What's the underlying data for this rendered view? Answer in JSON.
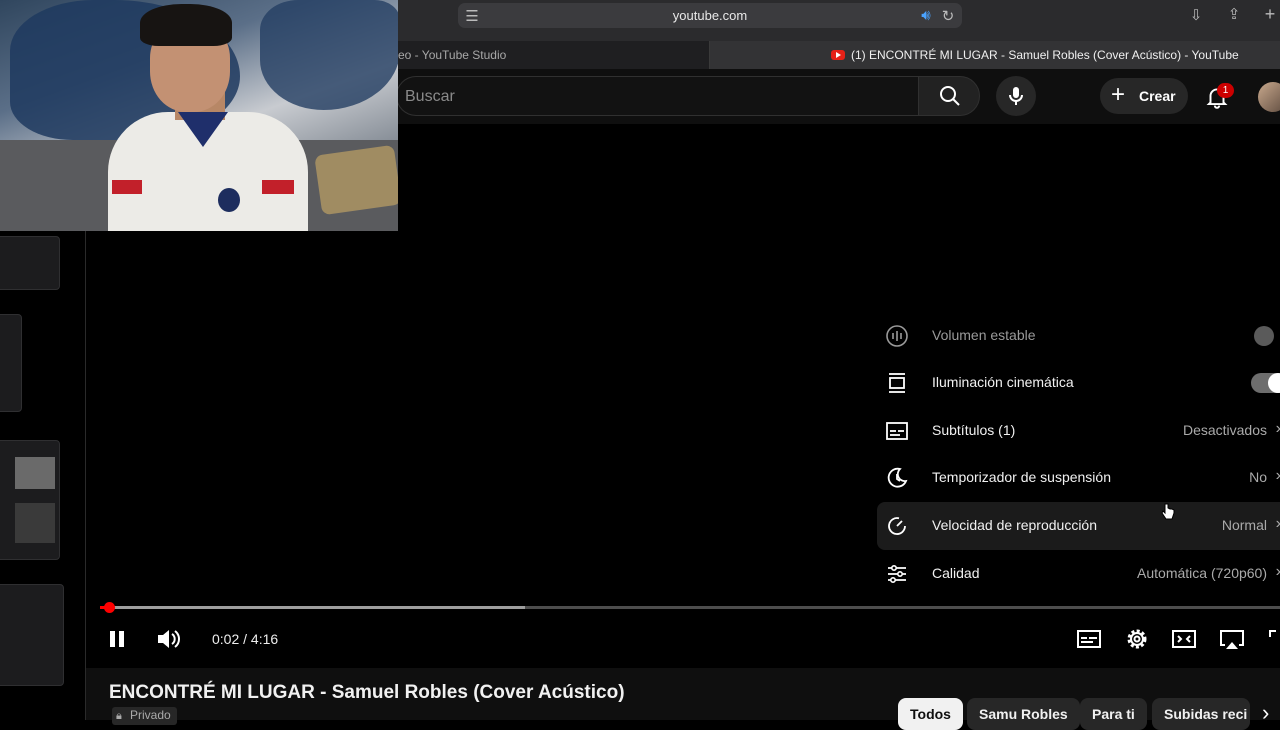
{
  "browser": {
    "url": "youtube.com",
    "tabs": [
      {
        "label": "eo - YouTube Studio"
      },
      {
        "label": "(1) ENCONTRÉ MI LUGAR - Samuel Robles (Cover Acústico) - YouTube"
      }
    ]
  },
  "header": {
    "search_placeholder": "Buscar",
    "create_label": "Crear",
    "notification_count": "1"
  },
  "player": {
    "time": "0:02 / 4:16",
    "progress_fraction": 0.008,
    "buffer_fraction": 0.36,
    "settings_menu": [
      {
        "label": "Volumen estable",
        "value": "",
        "icon": "stable-volume-icon",
        "control": "toggle-off",
        "dim": true
      },
      {
        "label": "Iluminación cinemática",
        "value": "",
        "icon": "ambient-mode-icon",
        "control": "toggle-on"
      },
      {
        "label": "Subtítulos (1)",
        "value": "Desactivados",
        "icon": "subtitles-icon"
      },
      {
        "label": "Temporizador de suspensión",
        "value": "No",
        "icon": "sleep-timer-icon"
      },
      {
        "label": "Velocidad de reproducción",
        "value": "Normal",
        "icon": "playback-speed-icon",
        "highlighted": true
      },
      {
        "label": "Calidad",
        "value": "Automática (720p60)",
        "icon": "quality-icon"
      }
    ]
  },
  "video": {
    "title": "ENCONTRÉ MI LUGAR - Samuel Robles (Cover Acústico)",
    "privacy": "Privado"
  },
  "chips": [
    {
      "label": "Todos",
      "active": true
    },
    {
      "label": "Samu Robles"
    },
    {
      "label": "Para ti"
    },
    {
      "label": "Subidas reci"
    }
  ],
  "colors": {
    "accent": "#ff0000",
    "badge": "#cc0000",
    "background": "#000000"
  }
}
